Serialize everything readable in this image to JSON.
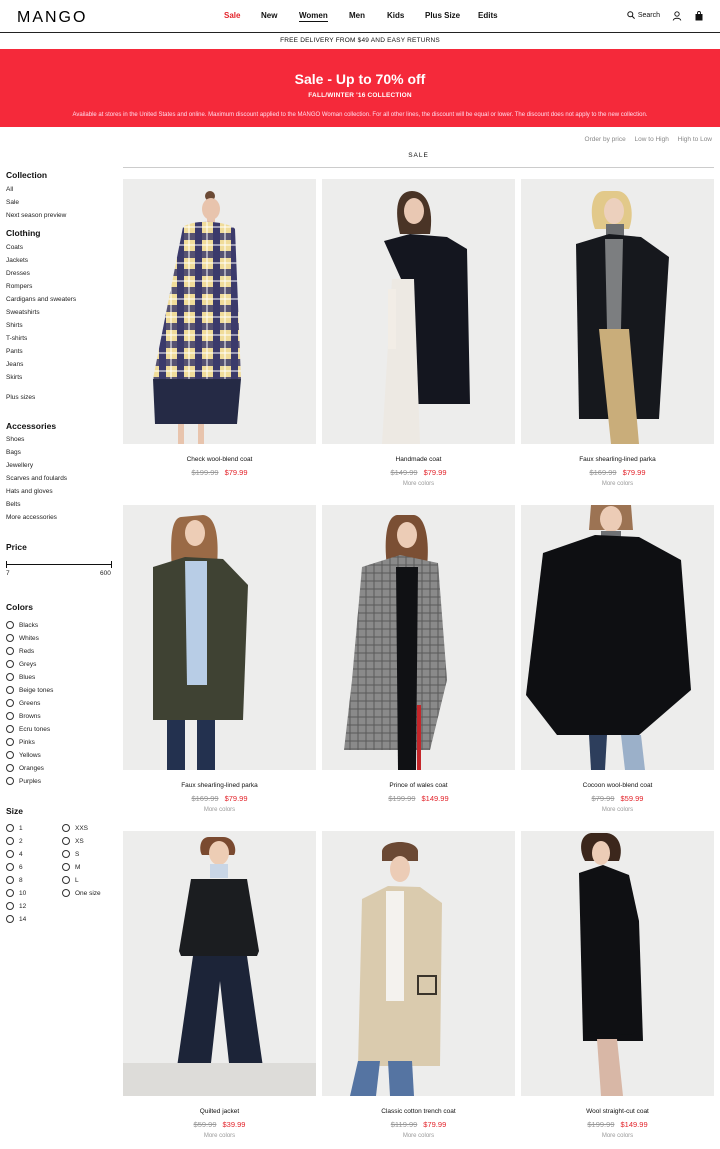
{
  "header": {
    "logo": "MANGO",
    "nav": [
      "Sale",
      "New",
      "Women",
      "Men",
      "Kids",
      "Plus Size",
      "Edits"
    ],
    "search_label": "Search"
  },
  "delivery": "FREE DELIVERY FROM $49 AND EASY RETURNS",
  "banner": {
    "title": "Sale - Up to 70% off",
    "subtitle": "FALL/WINTER '16 COLLECTION",
    "note": "Available at stores in the United States and online. Maximum discount applied to the MANGO Woman collection. For all other lines, the discount will be equal or lower. The discount does not apply to the new collection.",
    "color": "#f5293a"
  },
  "sort": {
    "label": "Order by price",
    "low": "Low to High",
    "high": "High to Low"
  },
  "section_heading": "SALE",
  "sidebar": {
    "collection_title": "Collection",
    "collection": [
      "All",
      "Sale",
      "Next season preview"
    ],
    "clothing_title": "Clothing",
    "clothing": [
      "Coats",
      "Jackets",
      "Dresses",
      "Rompers",
      "Cardigans and sweaters",
      "Sweatshirts",
      "Shirts",
      "T-shirts",
      "Pants",
      "Jeans",
      "Skirts"
    ],
    "plus_sizes": "Plus sizes",
    "accessories_title": "Accessories",
    "accessories": [
      "Shoes",
      "Bags",
      "Jewellery",
      "Scarves and foulards",
      "Hats and gloves",
      "Belts",
      "More accessories"
    ],
    "price_title": "Price",
    "price_min": "7",
    "price_max": "600",
    "colors_title": "Colors",
    "colors": [
      "Blacks",
      "Whites",
      "Reds",
      "Greys",
      "Blues",
      "Beige tones",
      "Greens",
      "Browns",
      "Ecru tones",
      "Pinks",
      "Yellows",
      "Oranges",
      "Purples"
    ],
    "size_title": "Size",
    "sizes_left": [
      "1",
      "2",
      "4",
      "6",
      "8",
      "10",
      "12",
      "14"
    ],
    "sizes_right": [
      "XXS",
      "XS",
      "S",
      "M",
      "L",
      "One size"
    ]
  },
  "products": [
    {
      "name": "Check wool-blend coat",
      "old": "$199.99",
      "new": "$79.99",
      "more": ""
    },
    {
      "name": "Handmade coat",
      "old": "$149.99",
      "new": "$79.99",
      "more": "More colors"
    },
    {
      "name": "Faux shearling-lined parka",
      "old": "$169.99",
      "new": "$79.99",
      "more": "More colors"
    },
    {
      "name": "Faux shearling-lined parka",
      "old": "$169.99",
      "new": "$79.99",
      "more": "More colors"
    },
    {
      "name": "Prince of wales coat",
      "old": "$199.99",
      "new": "$149.99",
      "more": ""
    },
    {
      "name": "Cocoon wool-blend coat",
      "old": "$79.99",
      "new": "$59.99",
      "more": "More colors"
    },
    {
      "name": "Quilted jacket",
      "old": "$59.99",
      "new": "$39.99",
      "more": "More colors"
    },
    {
      "name": "Classic cotton trench coat",
      "old": "$119.99",
      "new": "$79.99",
      "more": "More colors"
    },
    {
      "name": "Wool straight-cut coat",
      "old": "$199.99",
      "new": "$149.99",
      "more": "More colors"
    }
  ]
}
